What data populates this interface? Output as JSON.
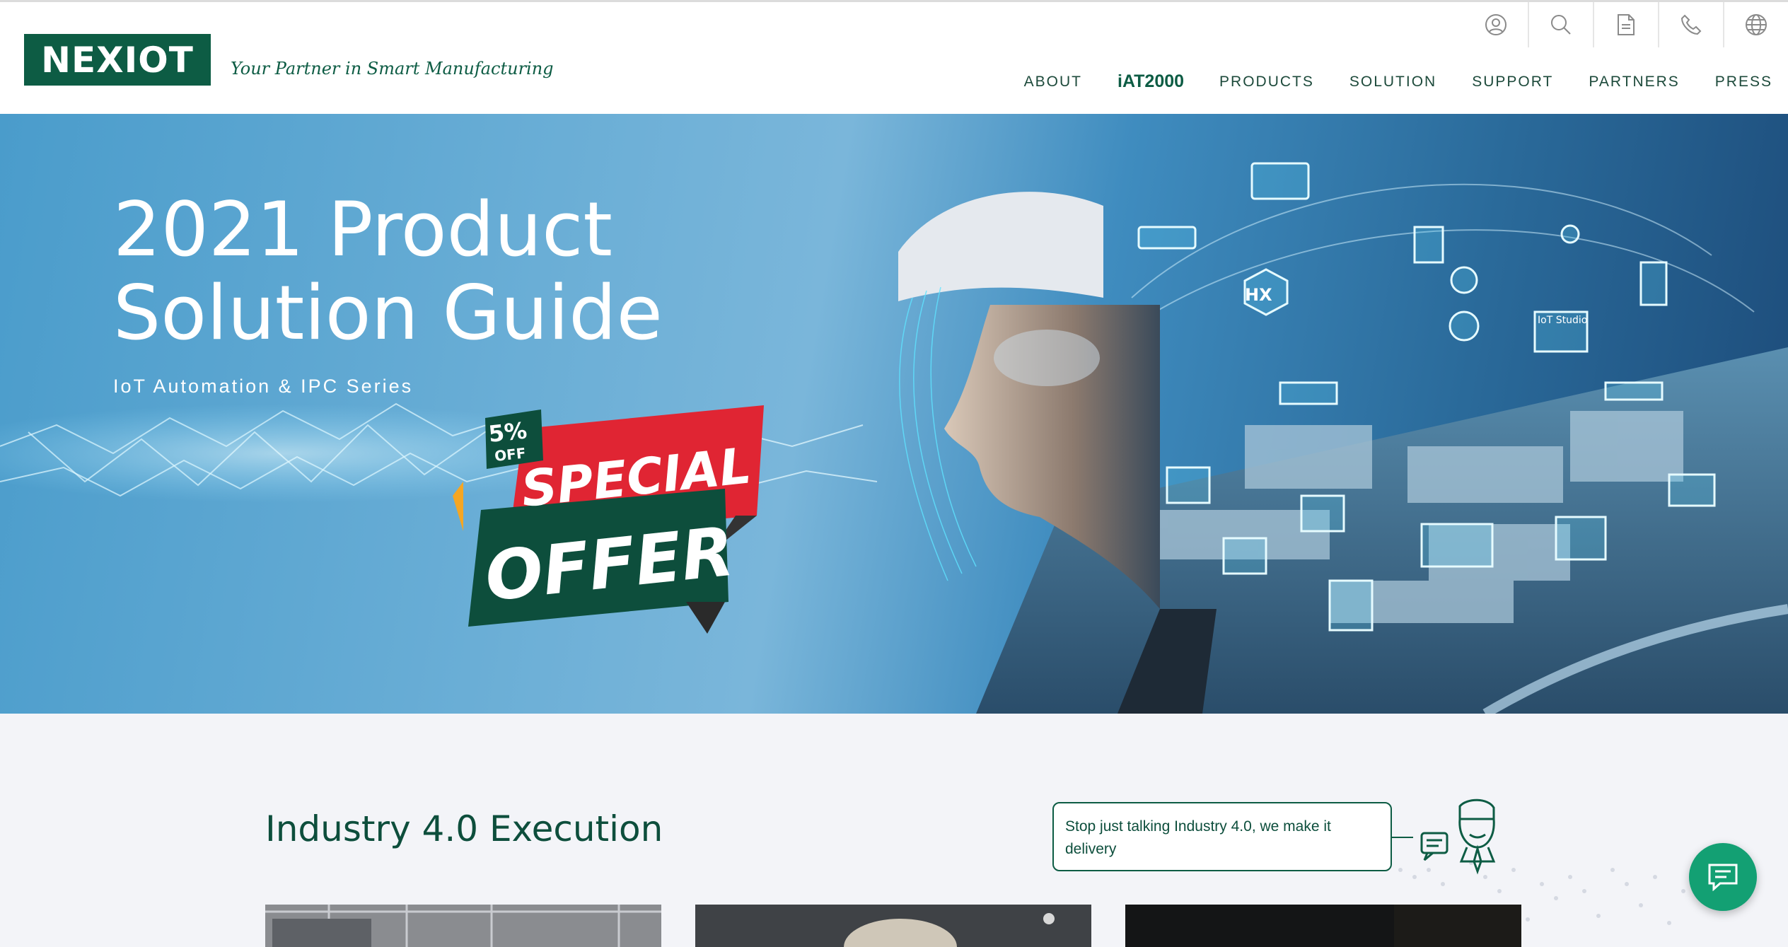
{
  "brand": {
    "logo_text": "NEXIOT",
    "tagline": "Your Partner in Smart Manufacturing",
    "color": "#0d5c44"
  },
  "utility_icons": [
    "user-icon",
    "search-icon",
    "document-icon",
    "phone-icon",
    "globe-icon"
  ],
  "nav": {
    "about": "ABOUT",
    "iat": "iAT2000",
    "products": "PRODUCTS",
    "solution": "SOLUTION",
    "support": "SUPPORT",
    "partners": "PARTNERS",
    "press": "PRESS"
  },
  "hero": {
    "title_line1": "2021 Product",
    "title_line2": "Solution Guide",
    "subtitle": "IoT Automation & IPC Series",
    "badge_percent": "5%",
    "badge_off": "OFF",
    "ribbon_top": "SPECIAL",
    "ribbon_bottom": "OFFER",
    "hologram_labels": {
      "hx": "HX",
      "iot_studio": "IoT Studio"
    }
  },
  "section": {
    "title": "Industry 4.0 Execution",
    "bubble_text": "Stop just talking Industry 4.0, we make it delivery"
  },
  "chat": {
    "icon": "chat-icon",
    "color": "#13a073"
  }
}
